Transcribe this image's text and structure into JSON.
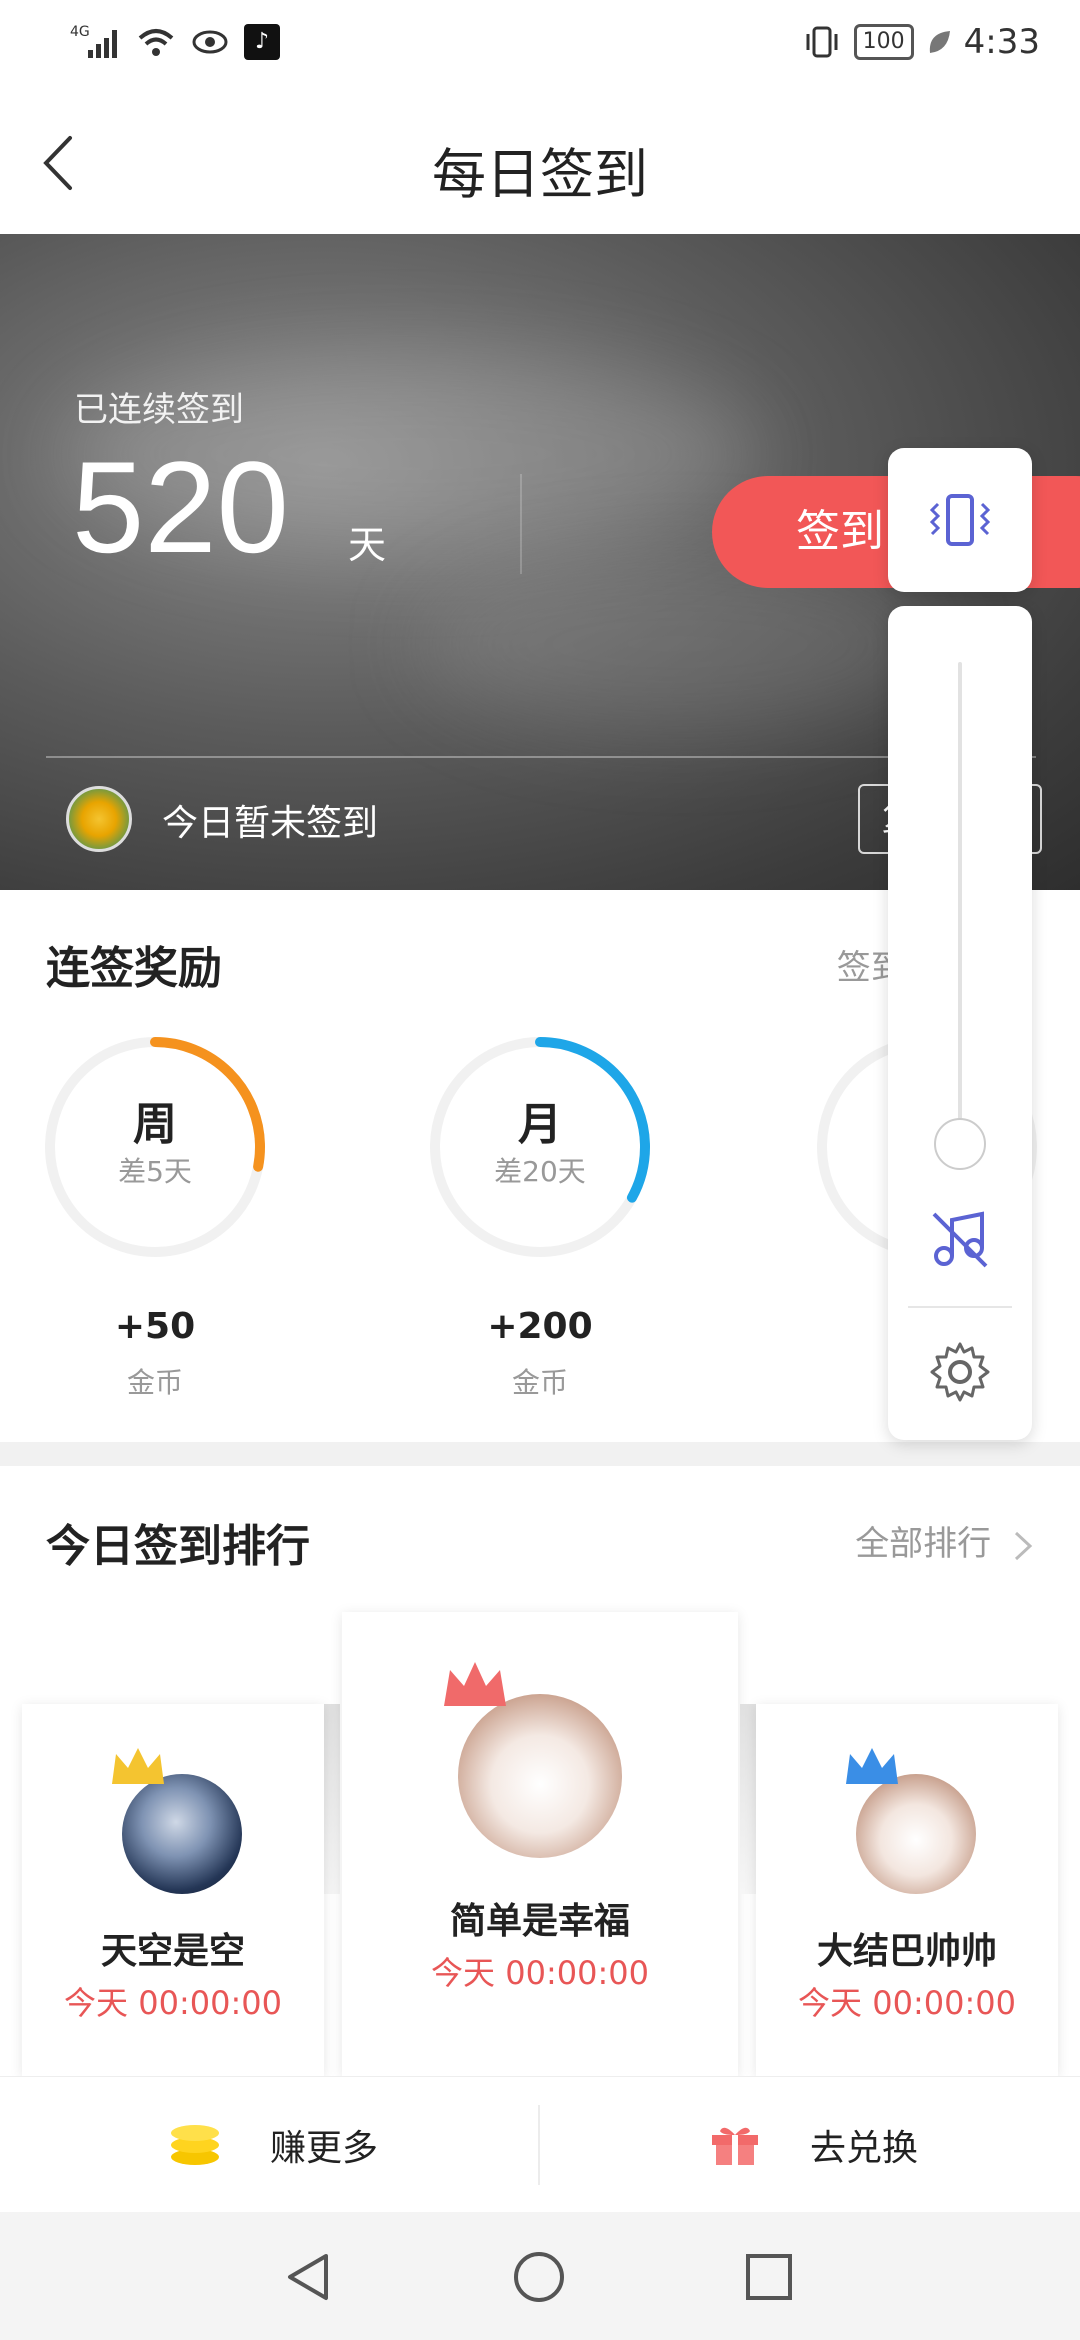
{
  "status_bar": {
    "network": "4G",
    "battery": "100",
    "time": "4:33"
  },
  "header": {
    "title": "每日签到"
  },
  "hero": {
    "label": "已连续签到",
    "days": "520",
    "unit": "天",
    "checkin_label": "签到",
    "status_text": "今日暂未签到",
    "small_button": "复"
  },
  "rewards": {
    "title": "连签奖励",
    "record_link": "签到记录(可",
    "items": [
      {
        "title": "周",
        "sub": "差5天",
        "value": "+50",
        "unit": "金币",
        "color": "#f5921e",
        "progress": 0.28
      },
      {
        "title": "月",
        "sub": "差20天",
        "value": "+200",
        "unit": "金币",
        "color": "#1ea6e8",
        "progress": 0.33
      },
      {
        "title": "",
        "sub": "差",
        "value": "+",
        "unit": "",
        "color": "#f25757",
        "progress": 0.2
      }
    ]
  },
  "ranking": {
    "title": "今日签到排行",
    "all_link": "全部排行",
    "users": [
      {
        "name": "天空是空",
        "time": "今天 00:00:00",
        "crown_color": "#f4c430"
      },
      {
        "name": "简单是幸福",
        "time": "今天 00:00:00",
        "crown_color": "#f06a6a"
      },
      {
        "name": "大结巴帅帅",
        "time": "今天 00:00:00",
        "crown_color": "#3a8ee6"
      }
    ]
  },
  "bottom_actions": {
    "earn_more": "赚更多",
    "exchange": "去兑换"
  },
  "colors": {
    "accent": "#f25757",
    "volume_icon": "#5b63d3"
  }
}
